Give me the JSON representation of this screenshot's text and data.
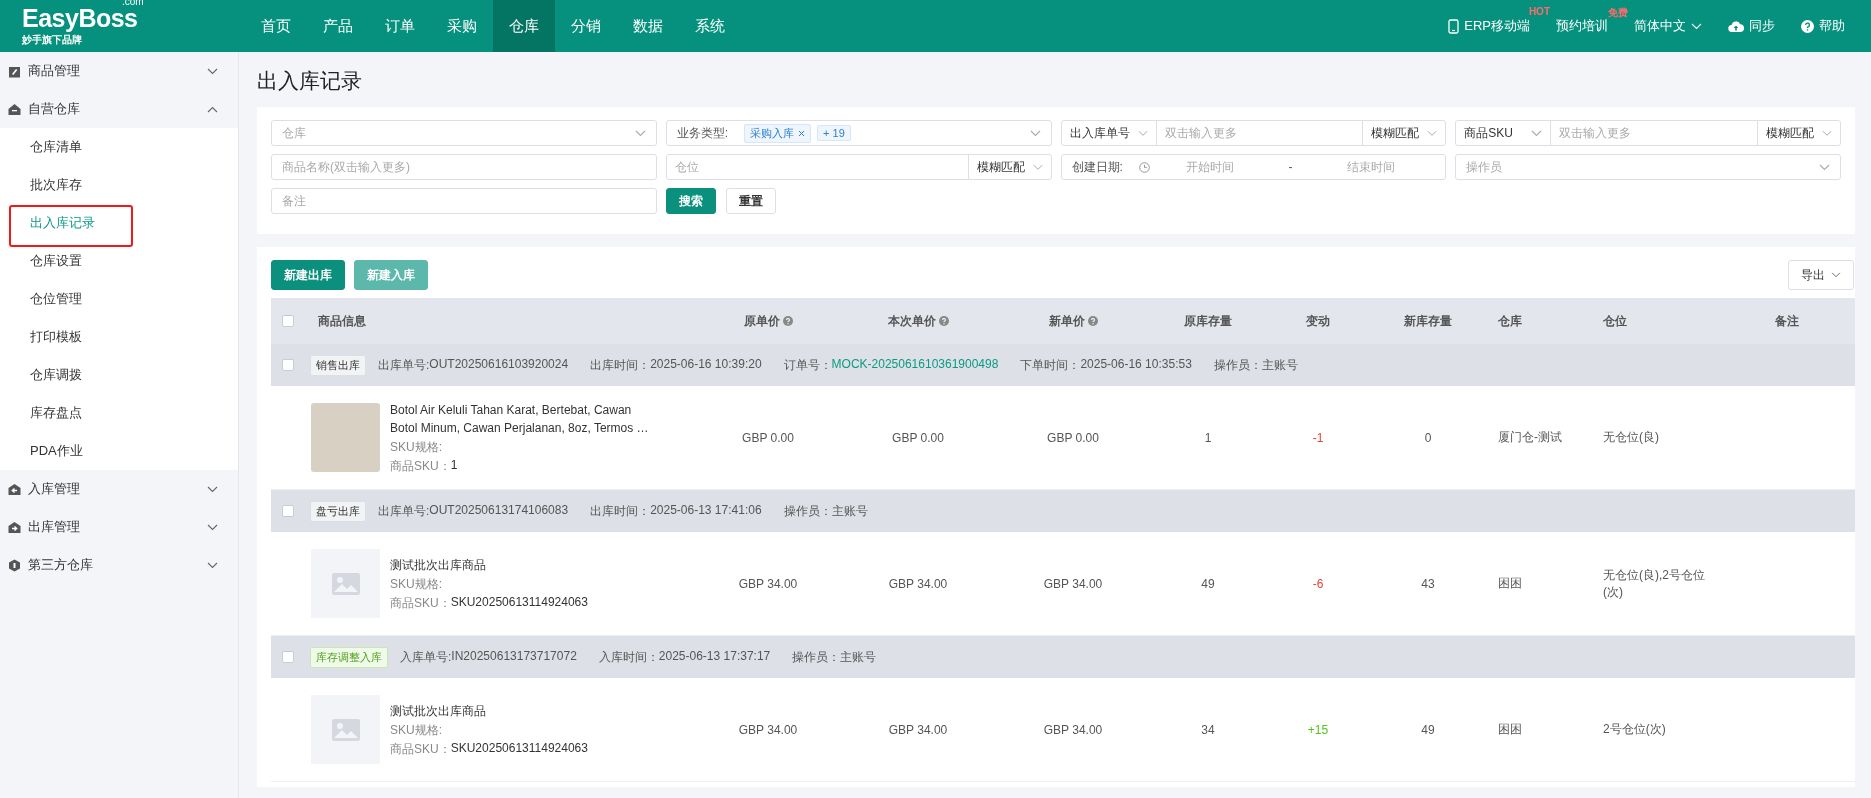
{
  "logo": {
    "name": "EasyBoss",
    "domain": ".com",
    "tagline": "妙手旗下品牌"
  },
  "nav": [
    {
      "label": "首页",
      "selected": false
    },
    {
      "label": "产品",
      "selected": false
    },
    {
      "label": "订单",
      "selected": false
    },
    {
      "label": "采购",
      "selected": false
    },
    {
      "label": "仓库",
      "selected": true
    },
    {
      "label": "分销",
      "selected": false
    },
    {
      "label": "数据",
      "selected": false
    },
    {
      "label": "系统",
      "selected": false
    }
  ],
  "top_actions": [
    {
      "kind": "mobile",
      "label": "ERP移动端",
      "badge": "HOT"
    },
    {
      "kind": "training",
      "label": "预约培训",
      "badge": "免费"
    },
    {
      "kind": "language",
      "label": "简体中文"
    },
    {
      "kind": "sync",
      "label": "同步"
    },
    {
      "kind": "help",
      "label": "帮助"
    }
  ],
  "sidebar": [
    {
      "label": "商品管理",
      "expanded": false
    },
    {
      "label": "自营仓库",
      "expanded": true,
      "children": [
        {
          "label": "仓库清单",
          "selected": false,
          "annotated": false
        },
        {
          "label": "批次库存",
          "selected": false,
          "annotated": false
        },
        {
          "label": "出入库记录",
          "selected": true,
          "annotated": true
        },
        {
          "label": "仓库设置",
          "selected": false,
          "annotated": false
        },
        {
          "label": "仓位管理",
          "selected": false,
          "annotated": false
        },
        {
          "label": "打印模板",
          "selected": false,
          "annotated": false
        },
        {
          "label": "仓库调拨",
          "selected": false,
          "annotated": false
        },
        {
          "label": "库存盘点",
          "selected": false,
          "annotated": false
        },
        {
          "label": "PDA作业",
          "selected": false,
          "annotated": false
        }
      ]
    },
    {
      "label": "入库管理",
      "expanded": false
    },
    {
      "label": "出库管理",
      "expanded": false
    },
    {
      "label": "第三方仓库",
      "expanded": false
    }
  ],
  "page_title": "出入库记录",
  "filters": [
    {
      "kind": "select",
      "placeholder": "仓库"
    },
    {
      "kind": "tags",
      "label": "业务类型:",
      "tags": [
        {
          "text": "采购入库",
          "closable": true
        },
        {
          "text": "+ 19",
          "closable": false
        }
      ]
    },
    {
      "kind": "compound",
      "prefix": "出入库单号",
      "placeholder": "双击输入更多",
      "suffix": "模糊匹配"
    },
    {
      "kind": "compound",
      "prefix": "商品SKU",
      "placeholder": "双击输入更多",
      "suffix": "模糊匹配"
    },
    {
      "kind": "input",
      "placeholder": "商品名称(双击输入更多)"
    },
    {
      "kind": "compound",
      "placeholder": "仓位",
      "suffix": "模糊匹配"
    },
    {
      "kind": "daterange",
      "label": "创建日期:",
      "start": "开始时间",
      "separator": "-",
      "end": "结束时间"
    },
    {
      "kind": "select",
      "placeholder": "操作员"
    },
    {
      "kind": "input",
      "placeholder": "备注"
    },
    {
      "kind": "actions",
      "buttons": [
        {
          "label": "搜索",
          "primary": true
        },
        {
          "label": "重置",
          "primary": false
        }
      ]
    }
  ],
  "toolbar": {
    "buttons": [
      {
        "label": "新建出库",
        "disabled": false
      },
      {
        "label": "新建入库",
        "disabled": true
      }
    ],
    "export": "导出"
  },
  "table": {
    "select_all_checked": false,
    "columns": [
      {
        "label": "商品信息",
        "help": false
      },
      {
        "label": "原单价",
        "help": true
      },
      {
        "label": "本次单价",
        "help": true
      },
      {
        "label": "新单价",
        "help": true
      },
      {
        "label": "原库存量",
        "help": false
      },
      {
        "label": "变动",
        "help": false
      },
      {
        "label": "新库存量",
        "help": false
      },
      {
        "label": "仓库",
        "help": false
      },
      {
        "label": "仓位",
        "help": false
      },
      {
        "label": "备注",
        "help": false
      }
    ],
    "records": [
      {
        "checked": false,
        "tag": {
          "text": "销售出库",
          "kind": "neutral"
        },
        "meta": [
          {
            "label": "出库单号: ",
            "value": "OUT20250616103920024",
            "link": false
          },
          {
            "label": "出库时间：",
            "value": "2025-06-16 10:39:20",
            "link": false
          },
          {
            "label": "订单号：",
            "value": "MOCK-2025061610361900498",
            "link": true
          },
          {
            "label": "下单时间：",
            "value": "2025-06-16 10:35:53",
            "link": false
          },
          {
            "label": "操作员：",
            "value": "主账号",
            "link": false
          }
        ],
        "items": [
          {
            "has_photo": true,
            "name": "Botol Air Keluli Tahan Karat, Bertebat, Cawan Botol Minum, Cawan Perjalanan, 8oz, Termos …",
            "spec_label": "SKU规格:",
            "sku_label": "商品SKU：",
            "sku": "1",
            "orig_price": "GBP 0.00",
            "price": "GBP 0.00",
            "new_price": "GBP 0.00",
            "orig_qty": "1",
            "change": "-1",
            "color": "#e0453a",
            "new_qty": "0",
            "warehouse": "厦门仓-测试",
            "location": "无仓位(良)"
          }
        ]
      },
      {
        "checked": false,
        "tag": {
          "text": "盘亏出库",
          "kind": "neutral"
        },
        "meta": [
          {
            "label": "出库单号: ",
            "value": "OUT20250613174106083",
            "link": false
          },
          {
            "label": "出库时间：",
            "value": "2025-06-13 17:41:06",
            "link": false
          },
          {
            "label": "操作员：",
            "value": "主账号",
            "link": false
          }
        ],
        "items": [
          {
            "has_photo": false,
            "name": "测试批次出库商品",
            "spec_label": "SKU规格:",
            "sku_label": "商品SKU：",
            "sku": "SKU20250613114924063",
            "orig_price": "GBP 34.00",
            "price": "GBP 34.00",
            "new_price": "GBP 34.00",
            "orig_qty": "49",
            "change": "-6",
            "color": "#e0453a",
            "new_qty": "43",
            "warehouse": "困困",
            "location": "无仓位(良),2号仓位(次)"
          }
        ]
      },
      {
        "checked": false,
        "tag": {
          "text": "库存调整入库",
          "kind": "success"
        },
        "meta": [
          {
            "label": "入库单号: ",
            "value": "IN20250613173717072",
            "link": false
          },
          {
            "label": "入库时间：",
            "value": "2025-06-13 17:37:17",
            "link": false
          },
          {
            "label": "操作员：",
            "value": "主账号",
            "link": false
          }
        ],
        "items": [
          {
            "has_photo": false,
            "name": "测试批次出库商品",
            "spec_label": "SKU规格:",
            "sku_label": "商品SKU：",
            "sku": "SKU20250613114924063",
            "orig_price": "GBP 34.00",
            "price": "GBP 34.00",
            "new_price": "GBP 34.00",
            "orig_qty": "34",
            "change": "+15",
            "color": "#52c41a",
            "new_qty": "49",
            "warehouse": "困困",
            "location": "2号仓位(次)"
          }
        ]
      }
    ]
  }
}
